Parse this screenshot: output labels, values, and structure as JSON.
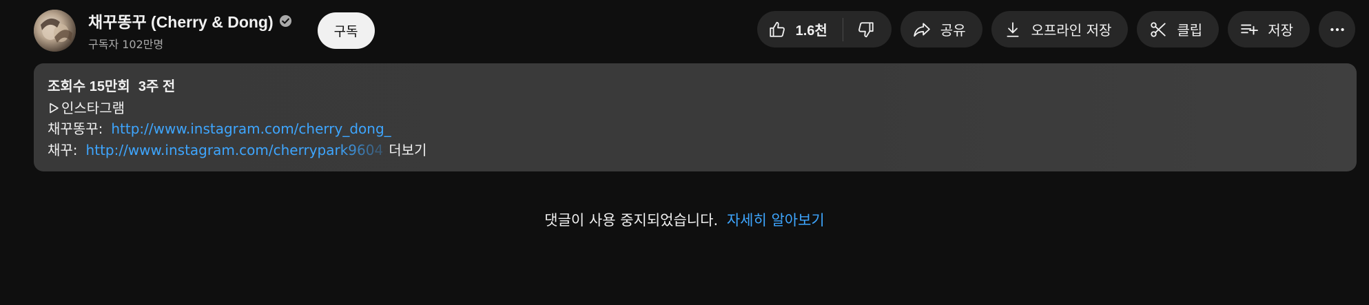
{
  "channel": {
    "name": "채꾸똥꾸 (Cherry & Dong)",
    "subscribers": "구독자 102만명",
    "subscribe_label": "구독",
    "verified_icon": "verified-check-icon"
  },
  "actions": {
    "like_count": "1.6천",
    "like_icon": "thumbs-up-icon",
    "dislike_icon": "thumbs-down-icon",
    "share_label": "공유",
    "download_label": "오프라인 저장",
    "clip_label": "클립",
    "save_label": "저장",
    "more_icon": "more-horizontal-icon"
  },
  "description": {
    "views": "조회수 15만회",
    "age": "3주 전",
    "instagram_heading": "인스타그램",
    "line_1_label": "채꾸똥꾸:",
    "line_1_link": "http://www.instagram.com/cherry_dong_",
    "line_2_label": "채꾸:",
    "line_2_link": "http://www.instagram.com/cherrypark9604",
    "more_label": "더보기"
  },
  "comments": {
    "disabled_text": "댓글이 사용 중지되었습니다.",
    "learn_more": "자세히 알아보기"
  },
  "colors": {
    "background": "#0f0f0f",
    "pill": "#272727",
    "link": "#3ea6ff",
    "description_bg": "#3a3a3a"
  }
}
